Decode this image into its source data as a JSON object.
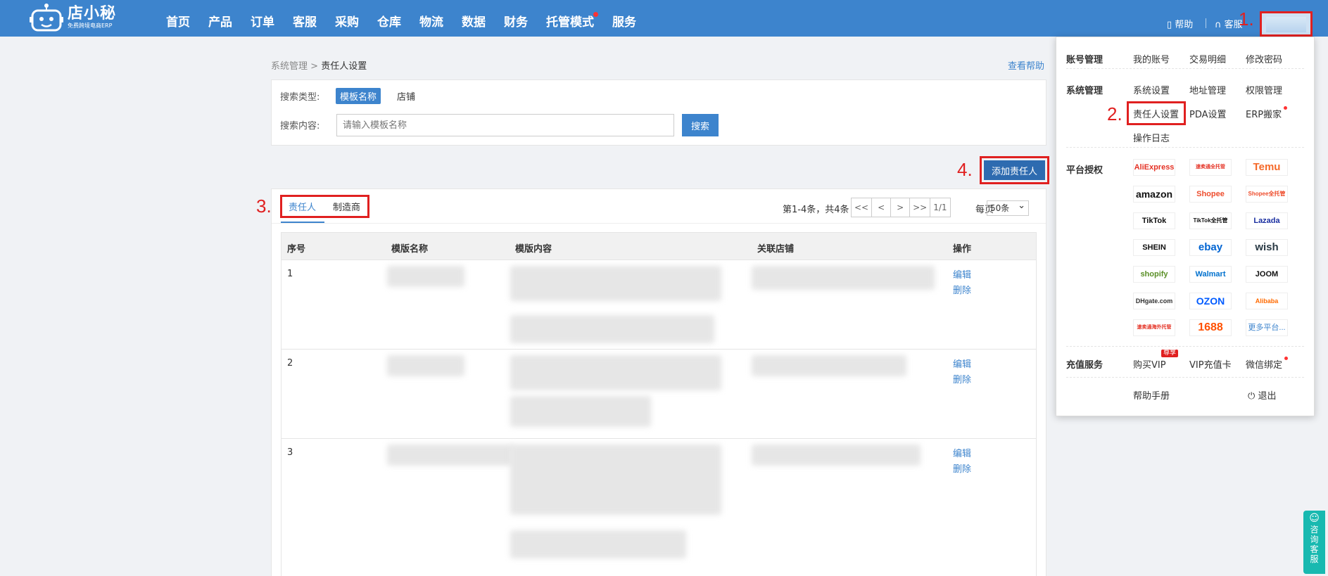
{
  "logo": {
    "title": "店小秘",
    "subtitle": "免费跨境电商ERP"
  },
  "nav": [
    "首页",
    "产品",
    "订单",
    "客服",
    "采购",
    "仓库",
    "物流",
    "数据",
    "财务",
    "托管模式",
    "服务"
  ],
  "header": {
    "help": "帮助",
    "service": "客服"
  },
  "annotations": {
    "a1": "1.",
    "a2": "2.",
    "a3": "3.",
    "a4": "4."
  },
  "breadcrumb": {
    "parent": "系统管理",
    "sep": ">",
    "current": "责任人设置"
  },
  "help_link": "查看帮助",
  "search": {
    "type_label": "搜索类型:",
    "types": [
      "模板名称",
      "店铺"
    ],
    "content_label": "搜索内容:",
    "placeholder": "请输入模板名称",
    "button": "搜索"
  },
  "add_button": "添加责任人",
  "tabs": [
    "责任人",
    "制造商"
  ],
  "pager": {
    "info": "第1-4条，共4条",
    "buttons": [
      "<<",
      "<",
      ">",
      ">>",
      "1/1"
    ],
    "per_page_label": "每页",
    "per_page_value": "50条"
  },
  "table": {
    "headers": [
      "序号",
      "模版名称",
      "模版内容",
      "关联店铺",
      "操作"
    ],
    "rows": [
      {
        "num": "1",
        "edit": "编辑",
        "delete": "删除"
      },
      {
        "num": "2",
        "edit": "编辑",
        "delete": "删除"
      },
      {
        "num": "3",
        "edit": "编辑",
        "delete": "删除"
      }
    ]
  },
  "dropdown": {
    "account": {
      "head": "账号管理",
      "items": [
        "我的账号",
        "交易明细",
        "修改密码"
      ]
    },
    "system": {
      "head": "系统管理",
      "items": [
        "系统设置",
        "地址管理",
        "权限管理",
        "责任人设置",
        "PDA设置",
        "ERP搬家",
        "操作日志"
      ]
    },
    "platform": {
      "head": "平台授权",
      "items": [
        "AliExpress",
        "速卖通全托管",
        "Temu",
        "amazon",
        "Shopee",
        "Shopee全托管",
        "TikTok",
        "TikTok全托管",
        "Lazada",
        "SHEIN",
        "ebay",
        "wish",
        "shopify",
        "Walmart",
        "JOOM",
        "DHgate.com",
        "OZON",
        "Alibaba",
        "速卖通海外托管",
        "1688",
        "更多平台..."
      ]
    },
    "recharge": {
      "head": "充值服务",
      "items": [
        "购买VIP",
        "VIP充值卡",
        "微信绑定"
      ],
      "vip_badge": "尊享"
    },
    "footer": {
      "manual": "帮助手册",
      "logout": "退出"
    }
  },
  "side_tab": "咨询客服",
  "colors": {
    "brand": "#3d84cd",
    "annotation": "#e02020",
    "side_tab": "#18b9b0"
  }
}
